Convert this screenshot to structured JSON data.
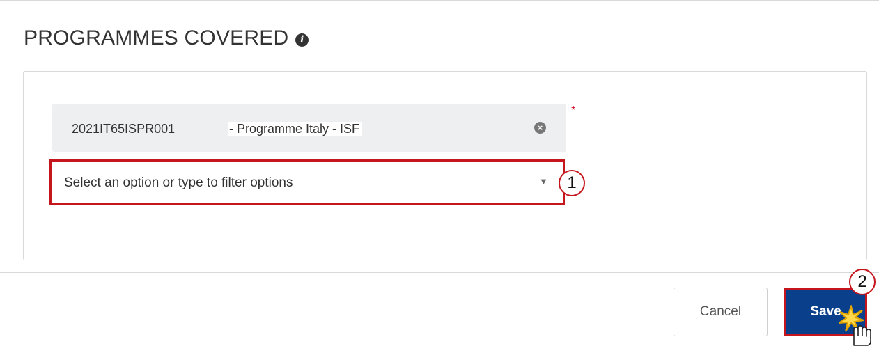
{
  "section": {
    "title": "PROGRAMMES COVERED",
    "info_icon": "info-icon"
  },
  "selected_programme": {
    "code": "2021IT65ISPR001",
    "description": "- Programme Italy - ISF",
    "remove_icon": "close-circle-icon"
  },
  "required_marker": "*",
  "programme_select": {
    "placeholder": "Select an option or type to filter options",
    "caret_icon": "caret-down-icon"
  },
  "callouts": {
    "first": "1",
    "second": "2"
  },
  "footer": {
    "cancel_label": "Cancel",
    "save_label": "Save"
  },
  "colors": {
    "highlight_border": "#c4161c",
    "primary_button": "#0a3f8c",
    "required": "#d0021b",
    "chip_background": "#eeeff1"
  },
  "cursor_icon": "hand-pointer-icon"
}
